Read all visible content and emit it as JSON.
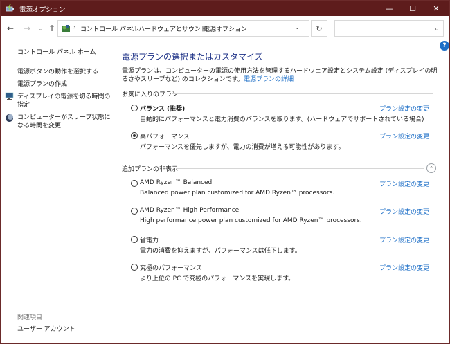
{
  "window": {
    "title": "電源オプション",
    "min_glyph": "—",
    "max_glyph": "☐",
    "close_glyph": "✕"
  },
  "nav": {
    "back_glyph": "←",
    "forward_glyph": "→",
    "recent_glyph": "⌄",
    "up_glyph": "↑",
    "refresh_glyph": "↻",
    "search_glyph": "⌕"
  },
  "address": {
    "crumbs": [
      "コントロール パネル",
      "ハードウェアとサウンド",
      "電源オプション"
    ],
    "separator": "›",
    "search_placeholder": ""
  },
  "sidebar": {
    "home": "コントロール パネル ホーム",
    "items": [
      {
        "label": "電源ボタンの動作を選択する",
        "icon": ""
      },
      {
        "label": "電源プランの作成",
        "icon": ""
      },
      {
        "label": "ディスプレイの電源を切る時間の指定",
        "icon": "display-power-icon"
      },
      {
        "label": "コンピューターがスリープ状態になる時間を変更",
        "icon": "sleep-moon-icon"
      }
    ],
    "related_label": "関連項目",
    "related_items": [
      "ユーザー アカウント"
    ]
  },
  "main": {
    "title": "電源プランの選択またはカスタマイズ",
    "description": "電源プランは、コンピューターの電源の使用方法を管理するハードウェア設定とシステム設定 (ディスプレイの明るさやスリープなど) のコレクションです。",
    "description_link": "電源プランの詳細",
    "favorites_label": "お気に入りのプラン",
    "hidden_label": "追加プランの非表示",
    "collapse_glyph": "⌃",
    "change_link": "プラン設定の変更",
    "favorite_plans": [
      {
        "name": "バランス (推奨)",
        "desc": "自動的にパフォーマンスと電力消費のバランスを取ります。(ハードウェアでサポートされている場合)",
        "selected": false,
        "bold": true
      },
      {
        "name": "高パフォーマンス",
        "desc": "パフォーマンスを優先しますが、電力の消費が増える可能性があります。",
        "selected": true,
        "bold": false
      }
    ],
    "extra_plans": [
      {
        "name": "AMD Ryzen™ Balanced",
        "desc": "Balanced power plan customized for AMD Ryzen™ processors.",
        "selected": false
      },
      {
        "name": "AMD Ryzen™ High Performance",
        "desc": "High performance power plan customized for AMD Ryzen™ processors.",
        "selected": false
      },
      {
        "name": "省電力",
        "desc": "電力の消費を抑えますが、パフォーマンスは低下します。",
        "selected": false
      },
      {
        "name": "究極のパフォーマンス",
        "desc": "より上位の PC で究極のパフォーマンスを実現します。",
        "selected": false
      }
    ]
  },
  "help": {
    "glyph": "?"
  },
  "colors": {
    "titlebar": "#5e1c1c",
    "link": "#1e6fc7",
    "heading": "#1e3287"
  }
}
